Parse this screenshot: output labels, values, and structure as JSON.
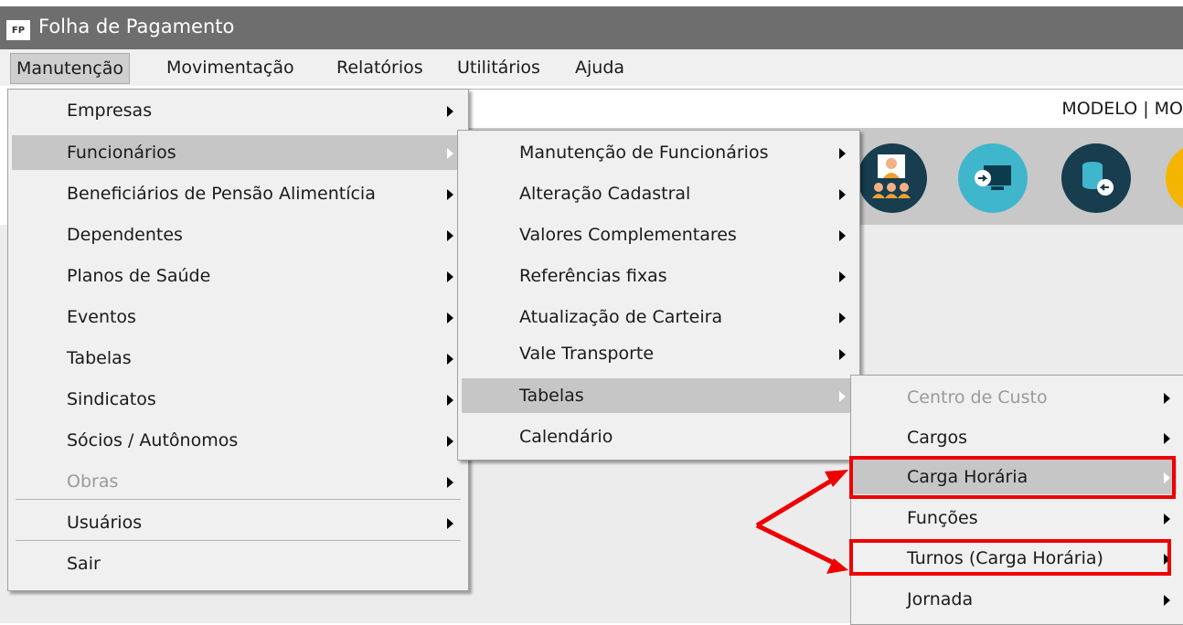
{
  "window": {
    "icon_text": "FP",
    "title": "Folha de Pagamento"
  },
  "menubar": {
    "items": [
      "Manutenção",
      "Movimentação",
      "Relatórios",
      "Utilitários",
      "Ajuda"
    ],
    "active": "Manutenção"
  },
  "infobar": {
    "company": "MODELO | MO"
  },
  "menu_manutencao": [
    {
      "label": "Empresas",
      "submenu": true
    },
    {
      "label": "Funcionários",
      "submenu": true,
      "highlighted": true
    },
    {
      "label": "Beneficiários de Pensão Alimentícia",
      "submenu": true
    },
    {
      "label": "Dependentes",
      "submenu": true
    },
    {
      "label": "Planos de Saúde",
      "submenu": true
    },
    {
      "label": "Eventos",
      "submenu": true
    },
    {
      "label": "Tabelas",
      "submenu": true
    },
    {
      "label": "Sindicatos",
      "submenu": true
    },
    {
      "label": "Sócios / Autônomos",
      "submenu": true
    },
    {
      "label": "Obras",
      "submenu": true,
      "disabled": true
    },
    {
      "label": "Usuários",
      "submenu": true
    },
    {
      "label": "Sair",
      "submenu": false
    }
  ],
  "menu_funcionarios": [
    {
      "label": "Manutenção de Funcionários",
      "submenu": true
    },
    {
      "label": "Alteração Cadastral",
      "submenu": true
    },
    {
      "label": "Valores Complementares",
      "submenu": true
    },
    {
      "label": "Referências fixas",
      "submenu": true
    },
    {
      "label": "Atualização de Carteira",
      "submenu": true
    },
    {
      "label": "Vale Transporte",
      "submenu": true
    },
    {
      "label": "Tabelas",
      "submenu": true,
      "highlighted": true
    },
    {
      "label": "Calendário",
      "submenu": false
    }
  ],
  "menu_tabelas": [
    {
      "label": "Centro de Custo",
      "submenu": true,
      "disabled": true
    },
    {
      "label": "Cargos",
      "submenu": true
    },
    {
      "label": "Carga Horária",
      "submenu": true,
      "highlighted": true,
      "callout": true
    },
    {
      "label": "Funções",
      "submenu": true
    },
    {
      "label": "Turnos (Carga Horária)",
      "submenu": true,
      "callout": true
    },
    {
      "label": "Jornada",
      "submenu": true
    }
  ],
  "toolbar": {
    "icons": [
      "employees-icon",
      "monitor-transfer-icon",
      "database-transfer-icon",
      "partial-icon"
    ]
  },
  "colors": {
    "callout": "#ee0000",
    "highlight": "#c6c6c6",
    "titlebar": "#6e6e6e",
    "toolbar": "#c8c8c8"
  }
}
